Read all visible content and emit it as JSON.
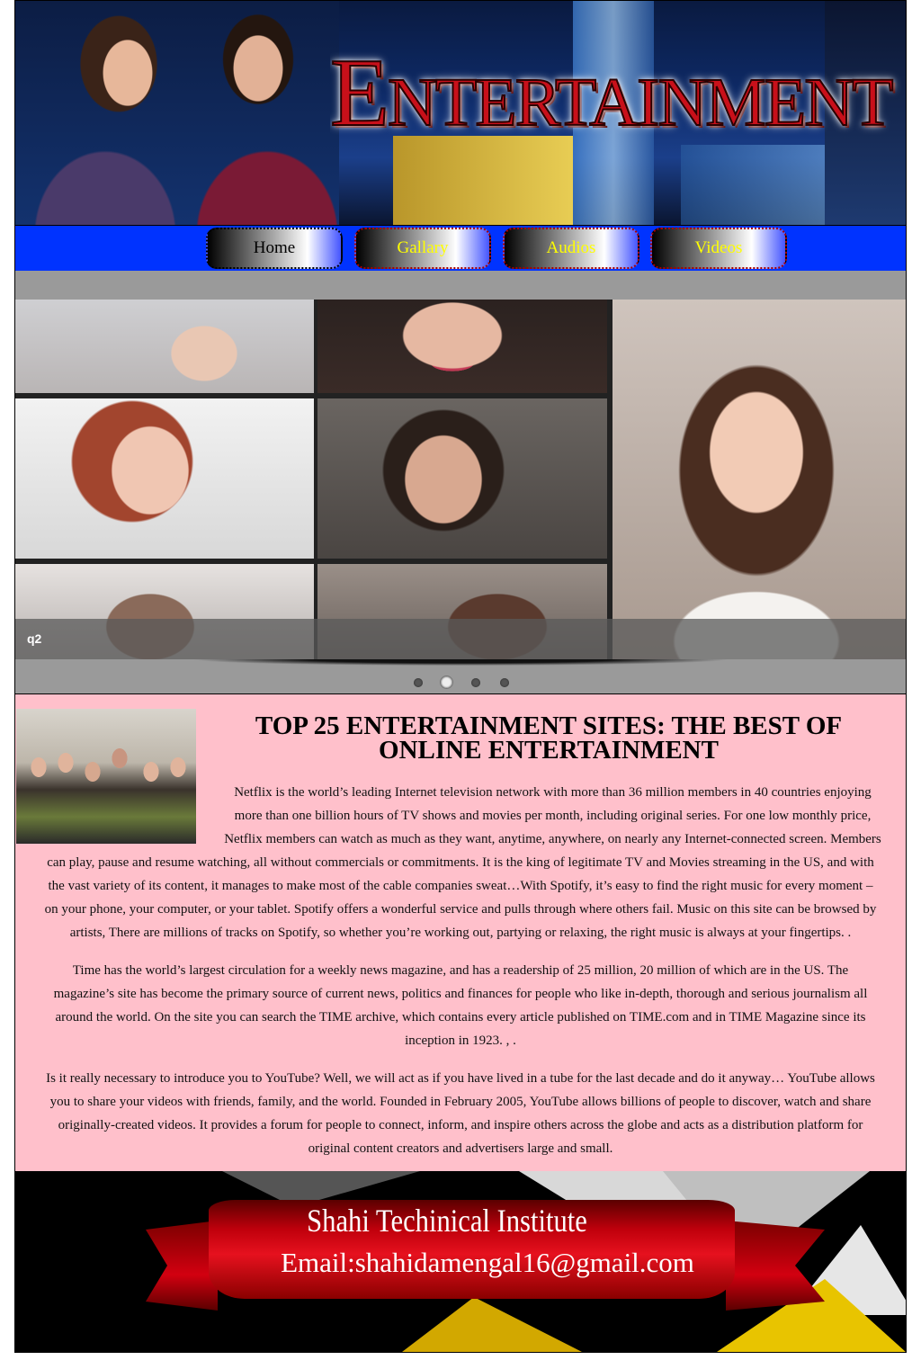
{
  "header": {
    "title": "Entertainment"
  },
  "nav": {
    "items": [
      {
        "label": "Home"
      },
      {
        "label": "Gallary"
      },
      {
        "label": "Audios"
      },
      {
        "label": "Videos"
      }
    ]
  },
  "slider": {
    "caption": "q2",
    "dots": 4,
    "active_dot_index": 1
  },
  "article": {
    "title": "TOP 25 ENTERTAINMENT SITES: THE BEST OF ONLINE ENTERTAINMENT",
    "p1_lines": [
      "Netflix is the world’s leading Internet television network with more than 36 million members in 40 countries enjoying",
      "more than one billion hours of TV shows and movies per month, including original series. For one low monthly price,",
      "Netflix members can watch as much as they want, anytime, anywhere, on nearly any Internet-connected screen. Members",
      "can play, pause and resume watching, all without commercials or commitments. It is the king of legitimate TV and Movies streaming in the US, and with",
      "the vast variety of its content, it manages to make most of the cable companies sweat…With Spotify, it’s easy to find the right music for every moment –",
      "on your phone, your computer, or your tablet. Spotify offers a wonderful service and pulls through where others fail. Music on this site can be browsed by",
      "artists, There are millions of tracks on Spotify, so whether you’re working out, partying or relaxing, the right music is always at your fingertips. ."
    ],
    "p2_lines": [
      "Time has the world’s largest circulation for a weekly news magazine, and has a readership of 25 million, 20 million of which are in the US. The",
      "magazine’s site has become the primary source of current news, politics and finances for people who like in-depth, thorough and serious journalism all",
      "around the world. On the site you can search the TIME archive, which contains every article published on TIME.com and in TIME Magazine since its",
      "inception in 1923. , ."
    ],
    "p3_lines": [
      "Is it really necessary to introduce you to YouTube? Well, we will act as if you have lived in a tube for the last decade and do it anyway… YouTube allows",
      "you to share your videos with friends, family, and the world. Founded in February 2005, YouTube allows billions of people to discover, watch and share",
      "originally-created videos. It provides a forum for people to connect, inform, and inspire others across the globe and acts as a distribution platform for",
      "original content creators and advertisers large and small."
    ]
  },
  "footer": {
    "institute": "Shahi Techinical Institute",
    "email": "Email:shahidamengal16@gmail.com"
  },
  "colors": {
    "nav_bg": "#0033ff",
    "nav_text": "#ffff00",
    "content_bg": "#ffc0cb",
    "ribbon": "#d20010"
  }
}
